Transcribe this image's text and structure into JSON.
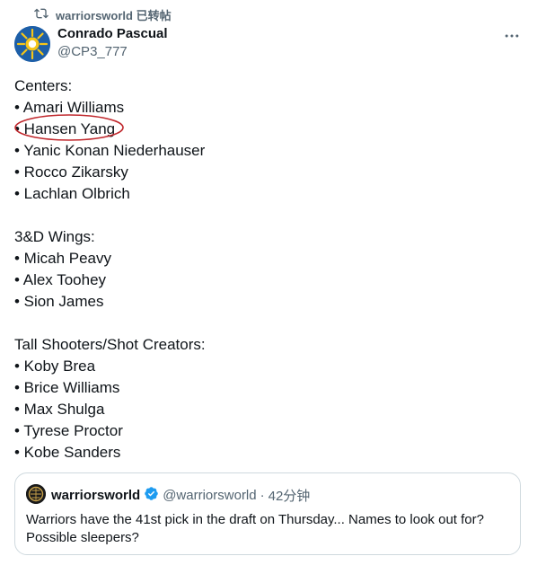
{
  "repost_banner": {
    "icon": "repost-icon",
    "text": "warriorsworld 已转帖"
  },
  "author": {
    "name": "Conrado Pascual",
    "handle": "@CP3_777",
    "avatar": "sun-flag-avatar"
  },
  "more_icon": "more-horizontal-icon",
  "post": {
    "sections": [
      {
        "heading": "Centers:",
        "items": [
          "• Amari Williams",
          "• Hansen Yang",
          "• Yanic Konan Niederhauser",
          "• Rocco Zikarsky",
          "• Lachlan Olbrich"
        ]
      },
      {
        "heading": "3&D Wings:",
        "items": [
          "• Micah Peavy",
          "• Alex Toohey",
          "• Sion James"
        ]
      },
      {
        "heading": "Tall Shooters/Shot Creators:",
        "items": [
          "• Koby Brea",
          "• Brice Williams",
          "• Max Shulga",
          "• Tyrese Proctor",
          "• Kobe Sanders"
        ]
      }
    ],
    "circled_item": "• Hansen Yang",
    "circle_color": "#c0282d"
  },
  "quoted_post": {
    "name": "warriorsworld",
    "verified_icon": "verified-badge-icon",
    "verified_color": "#1d9bf0",
    "handle": "@warriorsworld",
    "separator": "·",
    "time": "42分钟",
    "text": "Warriors have the 41st pick in the draft on Thursday... Names to look out for? Possible sleepers?"
  }
}
